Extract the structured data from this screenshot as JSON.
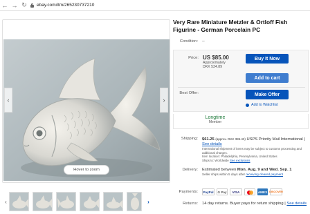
{
  "browser": {
    "back_icon": "arrow-left-icon",
    "forward_icon": "arrow-right-icon",
    "reload_icon": "reload-icon",
    "url": "ebay.com/itm/265230737210"
  },
  "gallery": {
    "hover_zoom_label": "Hover to zoom",
    "prev_arrow": "‹",
    "next_arrow": "›",
    "thumb_prev": "‹",
    "thumb_next": "›",
    "thumb_count": 7
  },
  "listing": {
    "title": "Very Rare Miniature Metzler & Ortloff Fish Figurine - German Porcelain PC",
    "condition_label": "Condition:",
    "condition_value": "--"
  },
  "buybox": {
    "price_label": "Price:",
    "price": "US $85.00",
    "approx_label": "Approximately",
    "approx_value": "DKK 534.89",
    "buy_now": "Buy It Now",
    "add_to_cart": "Add to cart",
    "best_offer_label": "Best Offer:",
    "make_offer": "Make Offer",
    "watchlist": "Add to Watchlist"
  },
  "seller": {
    "badge_title": "Longtime",
    "badge_sub": "Member"
  },
  "shipping": {
    "label": "Shipping:",
    "amount": "$61.25",
    "approx": "(approx. DKK 385.43)",
    "service": "USPS Priority Mail International",
    "details_link": "See details",
    "note": "International shipment of items may be subject to customs processing and additional charges.",
    "location": "Item location:  Philadelphia, Pennsylvania, United States",
    "ships_to": "Ships to:  Worldwide",
    "exclusions_link": "See exclusions"
  },
  "delivery": {
    "label": "Delivery:",
    "text_prefix": "Estimated between ",
    "date_range": "Mon. Aug. 9 and Wed. Sep. 1",
    "sub_prefix": "Seller ships within 5 days after ",
    "sub_link": "receiving cleared payment"
  },
  "payments": {
    "label": "Payments:",
    "methods": [
      "PayPal",
      "G Pay",
      "VISA",
      "Mastercard",
      "AMEX",
      "DISCOVER"
    ]
  },
  "returns": {
    "label": "Returns:",
    "text": "14 day returns. Buyer pays for return shipping |",
    "details_link": "See details"
  }
}
